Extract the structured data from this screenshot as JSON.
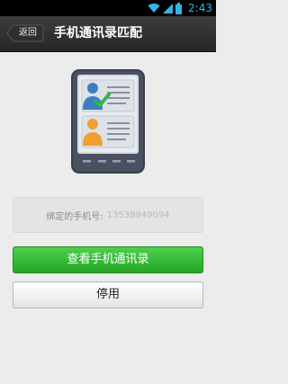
{
  "status_bar": {
    "time": "2:43"
  },
  "header": {
    "back_label": "返回",
    "title": "手机通讯录匹配"
  },
  "phone": {
    "label": "绑定的手机号:",
    "number": "13538949094"
  },
  "buttons": {
    "view_contacts": "查看手机通讯录",
    "disable": "停用"
  },
  "colors": {
    "primary_button": "#2bb22b",
    "status_time": "#33b5e5",
    "check": "#39b54a"
  }
}
